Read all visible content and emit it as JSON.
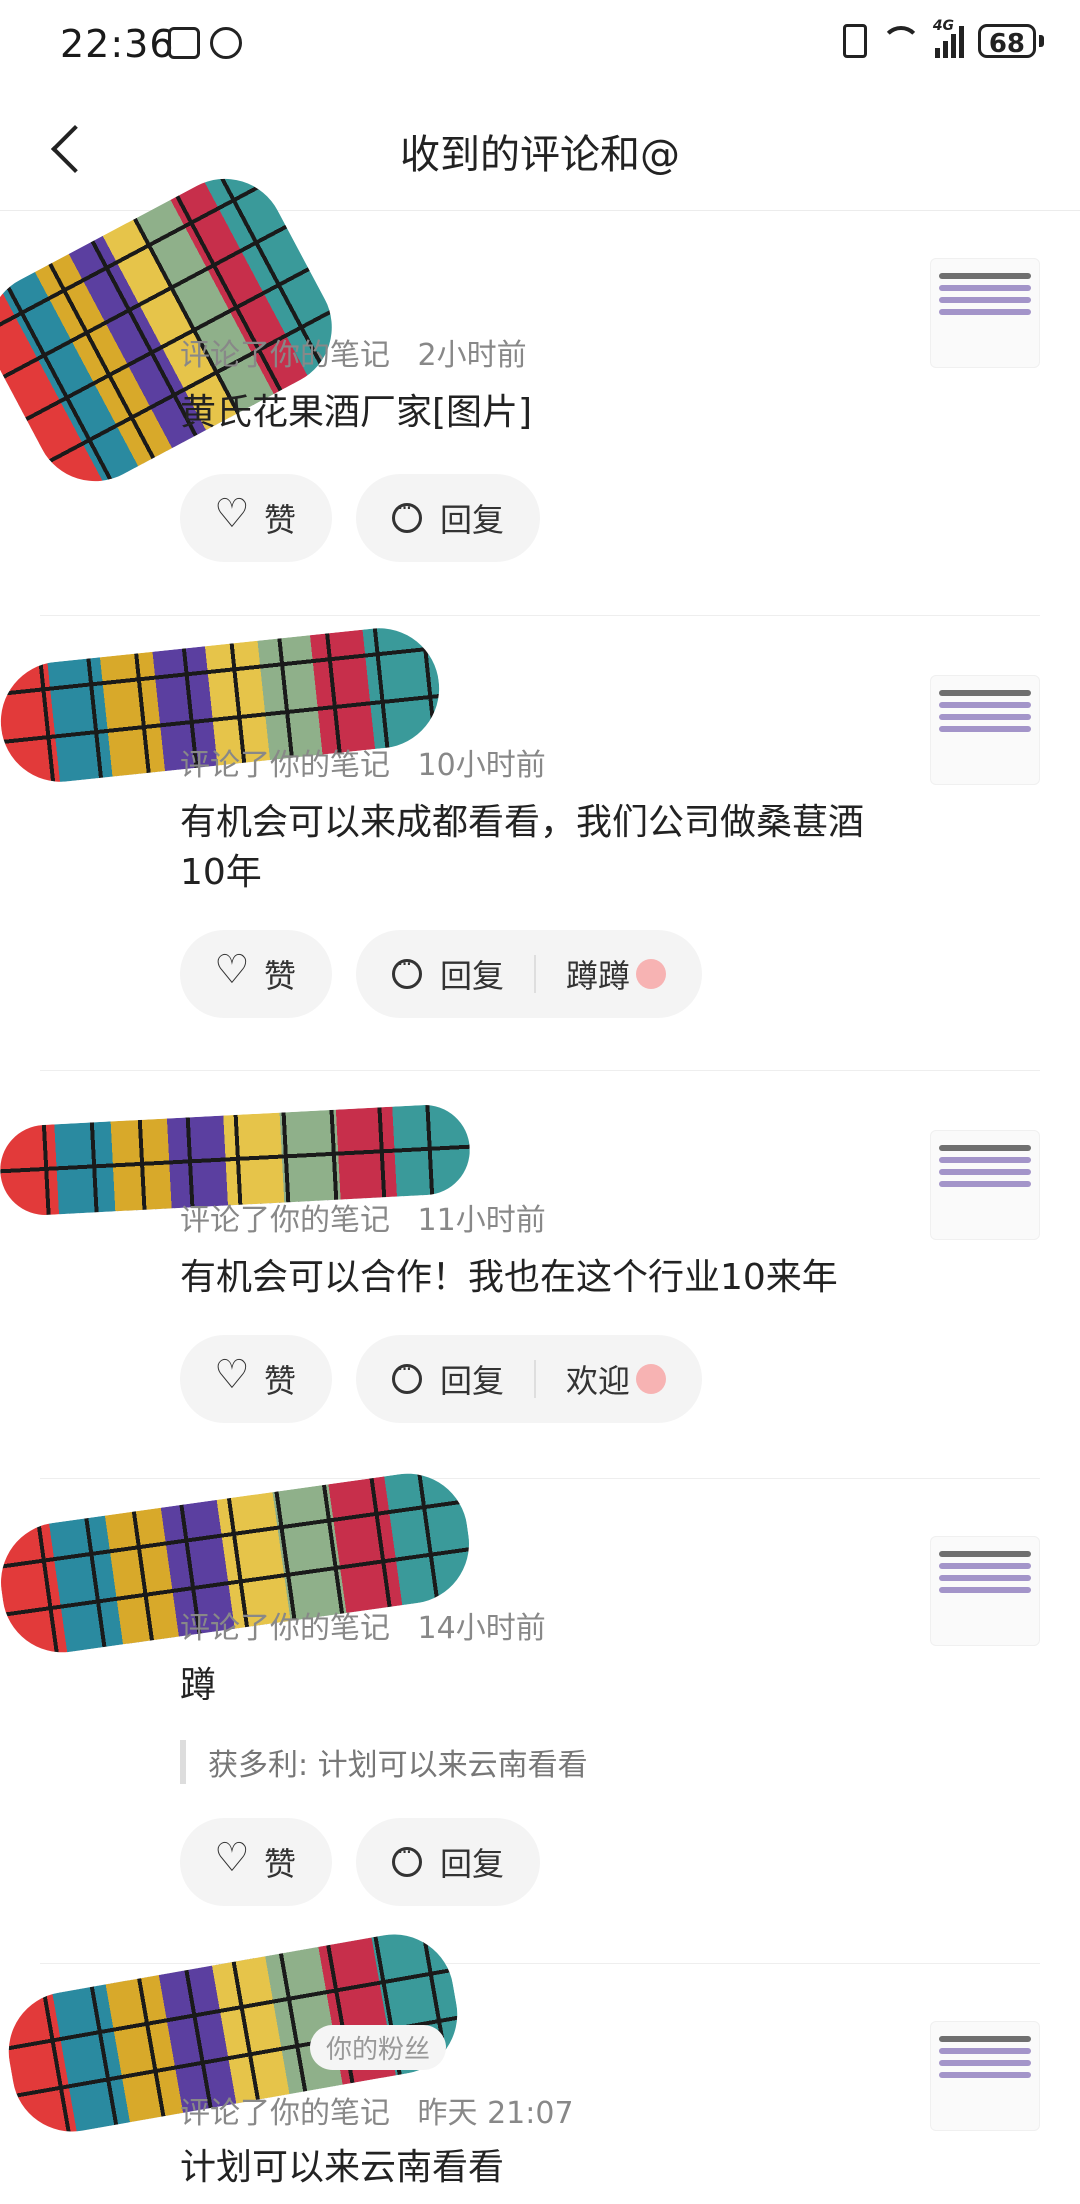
{
  "status_bar": {
    "time": "22:36",
    "battery": "68",
    "network": "4G"
  },
  "header": {
    "title": "收到的评论和@"
  },
  "items": [
    {
      "meta": {
        "action": "评论了你的笔记",
        "time": "2小时前"
      },
      "content": "黄氏花果酒厂家[图片]",
      "actions": {
        "like": "赞",
        "reply": "回复"
      }
    },
    {
      "meta": {
        "action": "评论了你的笔记",
        "time": "10小时前"
      },
      "content": "有机会可以来成都看看，我们公司做桑葚酒10年",
      "actions": {
        "like": "赞",
        "reply": "回复",
        "quick_reply": "蹲蹲"
      }
    },
    {
      "meta": {
        "action": "评论了你的笔记",
        "time": "11小时前"
      },
      "content": "有机会可以合作！我也在这个行业10来年",
      "actions": {
        "like": "赞",
        "reply": "回复",
        "quick_reply": "欢迎"
      }
    },
    {
      "meta": {
        "action": "评论了你的笔记",
        "time": "14小时前"
      },
      "content": "蹲",
      "quote": "获多利: 计划可以来云南看看",
      "actions": {
        "like": "赞",
        "reply": "回复"
      }
    },
    {
      "badge": "你的粉丝",
      "meta": {
        "action": "评论了你的笔记",
        "time": "昨天 21:07"
      },
      "content": "计划可以来云南看看"
    }
  ]
}
